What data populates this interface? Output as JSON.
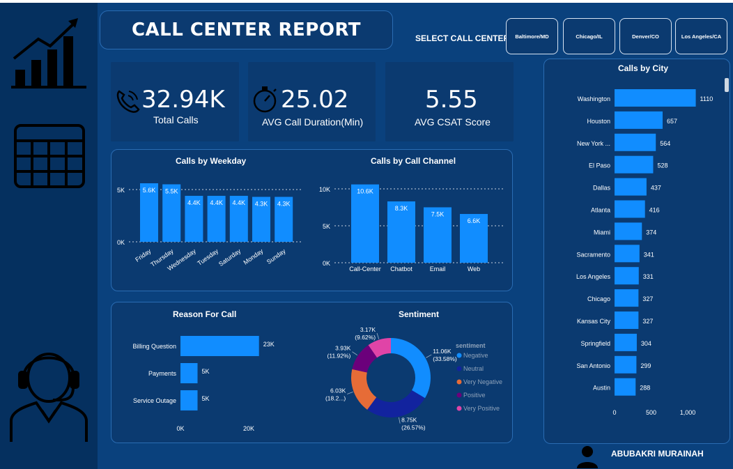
{
  "header": {
    "title": "CALL CENTER REPORT",
    "select_label": "SELECT CALL CENTER:",
    "call_centers": [
      "Baltimore/MD",
      "Chicago/IL",
      "Denver/CO",
      "Los Angeles/CA"
    ]
  },
  "sidebar": {
    "icons": [
      "growth-chart-icon",
      "calendar-grid-icon",
      "agent-headset-icon"
    ]
  },
  "kpis": [
    {
      "value": "32.94K",
      "label": "Total Calls",
      "icon": "phone-icon"
    },
    {
      "value": "25.02",
      "label": "AVG Call Duration(Min)",
      "icon": "stopwatch-icon"
    },
    {
      "value": "5.55",
      "label": "AVG CSAT Score"
    }
  ],
  "author": "ABUBAKRI MURAINAH",
  "colors": {
    "bar": "#118dff",
    "negative": "#118dff",
    "neutral": "#12239e",
    "very_negative": "#e66c37",
    "positive": "#6b007b",
    "very_positive": "#e044a7"
  },
  "chart_data": [
    {
      "id": "weekday",
      "type": "bar",
      "title": "Calls by Weekday",
      "categories": [
        "Friday",
        "Thursday",
        "Wednesday",
        "Tuesday",
        "Saturday",
        "Monday",
        "Sunday"
      ],
      "values": [
        5600,
        5500,
        4400,
        4400,
        4400,
        4300,
        4300
      ],
      "labels": [
        "5.6K",
        "5.5K",
        "4.4K",
        "4.4K",
        "4.4K",
        "4.3K",
        "4.3K"
      ],
      "yticks": [
        "0K",
        "5K"
      ],
      "ylim": [
        0,
        5000
      ]
    },
    {
      "id": "channel",
      "type": "bar",
      "title": "Calls by Call Channel",
      "categories": [
        "Call-Center",
        "Chatbot",
        "Email",
        "Web"
      ],
      "values": [
        10600,
        8300,
        7500,
        6600
      ],
      "labels": [
        "10.6K",
        "8.3K",
        "7.5K",
        "6.6K"
      ],
      "yticks": [
        "0K",
        "5K",
        "10K"
      ],
      "ylim": [
        0,
        10000
      ]
    },
    {
      "id": "reason",
      "type": "bar",
      "orientation": "horizontal",
      "title": "Reason For Call",
      "categories": [
        "Billing Question",
        "Payments",
        "Service Outage"
      ],
      "values": [
        23000,
        5000,
        5000
      ],
      "labels": [
        "23K",
        "5K",
        "5K"
      ],
      "xticks": [
        "0K",
        "20K"
      ],
      "xlim": [
        0,
        20000
      ]
    },
    {
      "id": "sentiment",
      "type": "pie",
      "title": "Sentiment",
      "legend_title": "sentiment",
      "legend": [
        "Negative",
        "Neutral",
        "Very Negative",
        "Positive",
        "Very Positive"
      ],
      "slices": [
        {
          "name": "Negative",
          "value": 11060,
          "label": "11.06K",
          "pct": "(33.58%)"
        },
        {
          "name": "Neutral",
          "value": 8750,
          "label": "8.75K",
          "pct": "(26.57%)"
        },
        {
          "name": "Very Negative",
          "value": 6030,
          "label": "6.03K",
          "pct": "(18.2...)"
        },
        {
          "name": "Positive",
          "value": 3930,
          "label": "3.93K",
          "pct": "(11.92%)"
        },
        {
          "name": "Very Positive",
          "value": 3170,
          "label": "3.17K",
          "pct": "(9.62%)"
        }
      ]
    },
    {
      "id": "city",
      "type": "bar",
      "orientation": "horizontal",
      "title": "Calls by City",
      "categories": [
        "Washington",
        "Houston",
        "New York ...",
        "El Paso",
        "Dallas",
        "Atlanta",
        "Miami",
        "Sacramento",
        "Los Angeles",
        "Chicago",
        "Kansas City",
        "Springfield",
        "San Antonio",
        "Austin"
      ],
      "values": [
        1110,
        657,
        564,
        528,
        437,
        416,
        374,
        341,
        331,
        327,
        327,
        304,
        299,
        288
      ],
      "xticks": [
        "0",
        "500",
        "1,000"
      ],
      "xlim": [
        0,
        1000
      ]
    }
  ]
}
